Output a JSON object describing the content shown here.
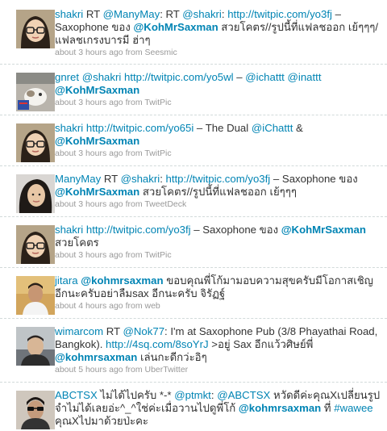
{
  "tweets": [
    {
      "avatar": "avatar-girl-glasses",
      "segments": [
        {
          "t": "user",
          "v": "shakri"
        },
        {
          "t": "text",
          "v": " RT "
        },
        {
          "t": "mention",
          "v": "@ManyMay"
        },
        {
          "t": "text",
          "v": ": RT "
        },
        {
          "t": "mention",
          "v": "@shakri"
        },
        {
          "t": "text",
          "v": ": "
        },
        {
          "t": "link",
          "v": "http://twitpic.com/yo3fj"
        },
        {
          "t": "text",
          "v": " – Saxophone ของ "
        },
        {
          "t": "mention_b",
          "v": "@KohMrSaxman"
        },
        {
          "t": "text",
          "v": " สวยโคตร//รูปนี้ที่แฟลชออก เย้ๆๆๆ/ แฟลชเกรงบารมี ฮ่าๆ"
        }
      ],
      "time": "about 3 hours ago",
      "source_prefix": " from ",
      "source": "Seesmic"
    },
    {
      "avatar": "avatar-cat",
      "segments": [
        {
          "t": "user",
          "v": "gnret"
        },
        {
          "t": "text",
          "v": " "
        },
        {
          "t": "mention",
          "v": "@shakri"
        },
        {
          "t": "text",
          "v": " "
        },
        {
          "t": "link",
          "v": "http://twitpic.com/yo5wl"
        },
        {
          "t": "text",
          "v": " – "
        },
        {
          "t": "mention",
          "v": "@ichattt"
        },
        {
          "t": "text",
          "v": " "
        },
        {
          "t": "mention",
          "v": "@inattt"
        },
        {
          "t": "text",
          "v": " "
        },
        {
          "t": "mention_b",
          "v": "@KohMrSaxman"
        }
      ],
      "time": "about 3 hours ago",
      "source_prefix": " from ",
      "source": "TwitPic"
    },
    {
      "avatar": "avatar-girl-glasses",
      "segments": [
        {
          "t": "user",
          "v": "shakri"
        },
        {
          "t": "text",
          "v": " "
        },
        {
          "t": "link",
          "v": "http://twitpic.com/yo65i"
        },
        {
          "t": "text",
          "v": " – The Dual "
        },
        {
          "t": "mention",
          "v": "@iChattt"
        },
        {
          "t": "text",
          "v": " & "
        },
        {
          "t": "mention_b",
          "v": "@KohMrSaxman"
        }
      ],
      "time": "about 3 hours ago",
      "source_prefix": " from ",
      "source": "TwitPic"
    },
    {
      "avatar": "avatar-manymay",
      "segments": [
        {
          "t": "user",
          "v": "ManyMay"
        },
        {
          "t": "text",
          "v": " RT "
        },
        {
          "t": "mention",
          "v": "@shakri"
        },
        {
          "t": "text",
          "v": ": "
        },
        {
          "t": "link",
          "v": "http://twitpic.com/yo3fj"
        },
        {
          "t": "text",
          "v": " – Saxophone ของ "
        },
        {
          "t": "mention_b",
          "v": "@KohMrSaxman"
        },
        {
          "t": "text",
          "v": " สวยโคตร//รูปนี้ที่แฟลชออก เย้ๆๆๆ"
        }
      ],
      "time": "about 3 hours ago",
      "source_prefix": " from ",
      "source": "TweetDeck"
    },
    {
      "avatar": "avatar-girl-glasses",
      "segments": [
        {
          "t": "user",
          "v": "shakri"
        },
        {
          "t": "text",
          "v": " "
        },
        {
          "t": "link",
          "v": "http://twitpic.com/yo3fj"
        },
        {
          "t": "text",
          "v": " – Saxophone ของ "
        },
        {
          "t": "mention_b",
          "v": "@KohMrSaxman"
        },
        {
          "t": "text",
          "v": " สวยโคตร"
        }
      ],
      "time": "about 3 hours ago",
      "source_prefix": " from ",
      "source": "TwitPic"
    },
    {
      "avatar": "avatar-jitara",
      "segments": [
        {
          "t": "user",
          "v": "jitara"
        },
        {
          "t": "text",
          "v": " "
        },
        {
          "t": "mention_b",
          "v": "@kohmrsaxman"
        },
        {
          "t": "text",
          "v": " ขอบคุณพี่โก้มามอบความสุขครับมีโอกาสเชิญอีกนะครับอย่าลืมsax อีกนะครับ จิรัฏฐ์"
        }
      ],
      "time": "about 4 hours ago",
      "source_prefix": " from ",
      "source": "web"
    },
    {
      "avatar": "avatar-wimarcom",
      "segments": [
        {
          "t": "user",
          "v": "wimarcom"
        },
        {
          "t": "text",
          "v": " RT "
        },
        {
          "t": "mention",
          "v": "@Nok77"
        },
        {
          "t": "text",
          "v": ": I'm at Saxophone Pub (3/8 Phayathai Road, Bangkok). "
        },
        {
          "t": "link",
          "v": "http://4sq.com/8soYrJ"
        },
        {
          "t": "text",
          "v": " >อยู่ Sax อีกแว้วศิษย์พี่ "
        },
        {
          "t": "mention_b",
          "v": "@kohmrsaxman"
        },
        {
          "t": "text",
          "v": " เล่นกะดีกว่ะอิๆ"
        }
      ],
      "time": "about 5 hours ago",
      "source_prefix": " from ",
      "source": "UberTwitter"
    },
    {
      "avatar": "avatar-abctsx",
      "segments": [
        {
          "t": "user",
          "v": "ABCTSX"
        },
        {
          "t": "text",
          "v": " ไม่ได้ไปครับ *-* "
        },
        {
          "t": "mention",
          "v": "@ptmkt"
        },
        {
          "t": "text",
          "v": ": "
        },
        {
          "t": "mention",
          "v": "@ABCTSX"
        },
        {
          "t": "text",
          "v": " หวัดดีค่ะคุณXเปลี่ยนรูปจำไม่ได้เลยอ่ะ^_^"
        },
        {
          "t": "text",
          "v": "ใช่ค่ะเมื่อวานไปดูพี่โก้ "
        },
        {
          "t": "mention_b",
          "v": "@kohmrsaxman"
        },
        {
          "t": "text",
          "v": " ที่ "
        },
        {
          "t": "mention",
          "v": "#wawee"
        },
        {
          "t": "text",
          "v": " คุณXไปมาด้วยป่ะคะ"
        }
      ],
      "time": "",
      "source_prefix": "",
      "source": ""
    }
  ]
}
